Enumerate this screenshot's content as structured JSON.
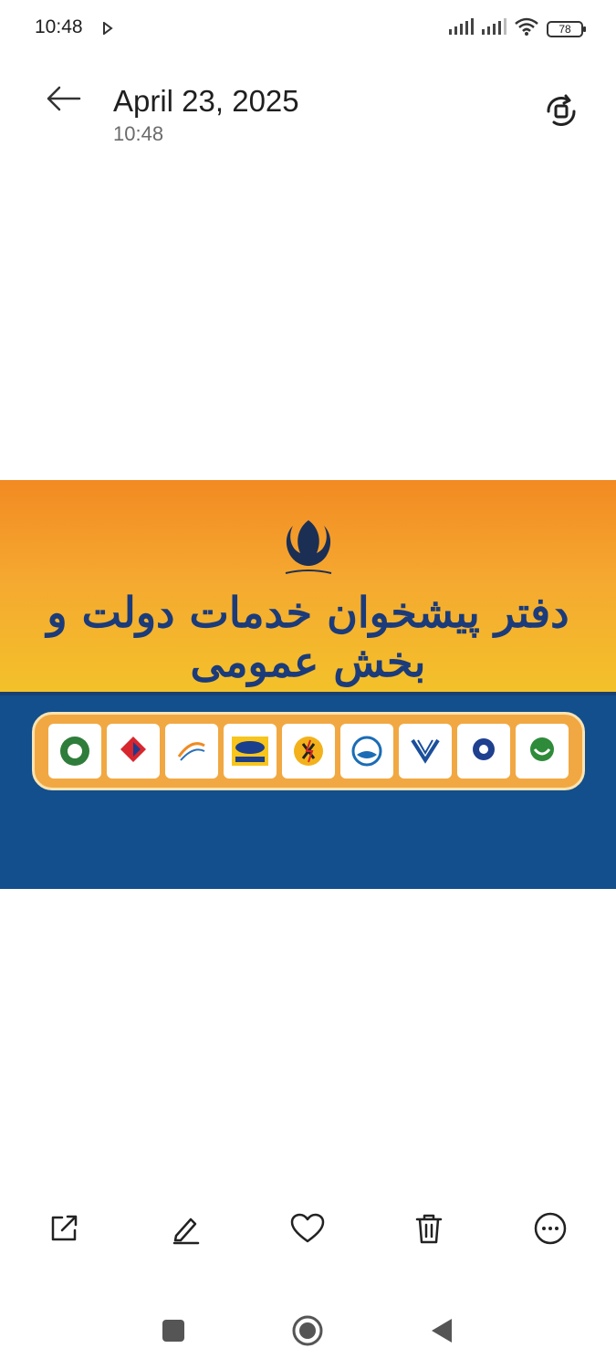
{
  "status_bar": {
    "time": "10:48",
    "battery": "78"
  },
  "header": {
    "date": "April 23, 2025",
    "time": "10:48"
  },
  "photo": {
    "banner_text": "دفتر پیشخوان خدمات دولت و بخش عمومی",
    "colors": {
      "top": "#f5a830",
      "bottom": "#124f8c"
    }
  },
  "actions": [
    "share-icon",
    "edit-icon",
    "heart-icon",
    "trash-icon",
    "more-icon"
  ],
  "nav": [
    "recents-icon",
    "home-icon",
    "back-triangle-icon"
  ]
}
